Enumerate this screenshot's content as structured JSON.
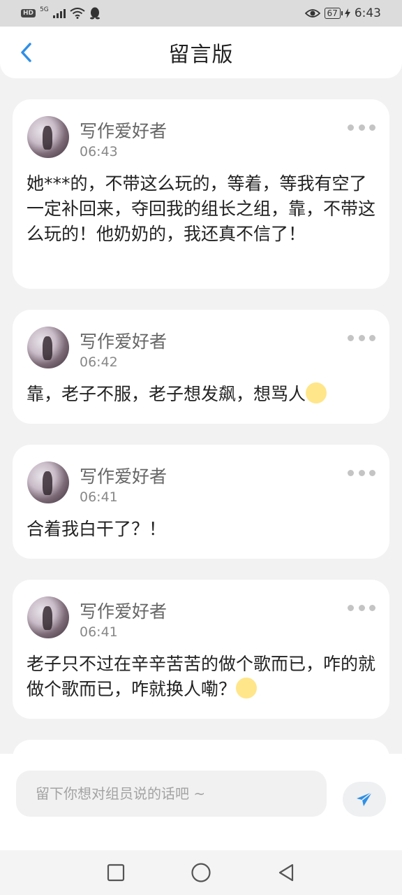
{
  "status": {
    "left_badge": "HD",
    "network": "5G",
    "battery": "67",
    "time": "6:43"
  },
  "header": {
    "title": "留言版"
  },
  "messages": [
    {
      "author": "写作爱好者",
      "time": "06:43",
      "text": "她***的，不带这么玩的，等着，等我有空了一定补回来，夺回我的组长之组，靠，不带这么玩的！他奶奶的，我还真不信了！",
      "emoji": ""
    },
    {
      "author": "写作爱好者",
      "time": "06:42",
      "text": "靠，老子不服，老子想发飙，想骂人",
      "emoji": "moon-face-emoji"
    },
    {
      "author": "写作爱好者",
      "time": "06:41",
      "text": "合着我白干了？！",
      "emoji": ""
    },
    {
      "author": "写作爱好者",
      "time": "06:41",
      "text": "老子只不过在辛辛苦苦的做个歌而已，咋的就做个歌而已，咋就换人嘞？",
      "emoji": "moon-face-emoji"
    }
  ],
  "composer": {
    "placeholder": "留下你想对组员说的话吧 ~",
    "value": ""
  },
  "colors": {
    "accent": "#2f8fe6",
    "background": "#f2f2f2",
    "card": "#ffffff",
    "muted_text": "#888888"
  },
  "icons": {
    "back": "chevron-left-icon",
    "more": "more-dots-icon",
    "send": "send-arrow-icon",
    "nav_recent": "square-icon",
    "nav_home": "circle-icon",
    "nav_back": "triangle-back-icon"
  }
}
